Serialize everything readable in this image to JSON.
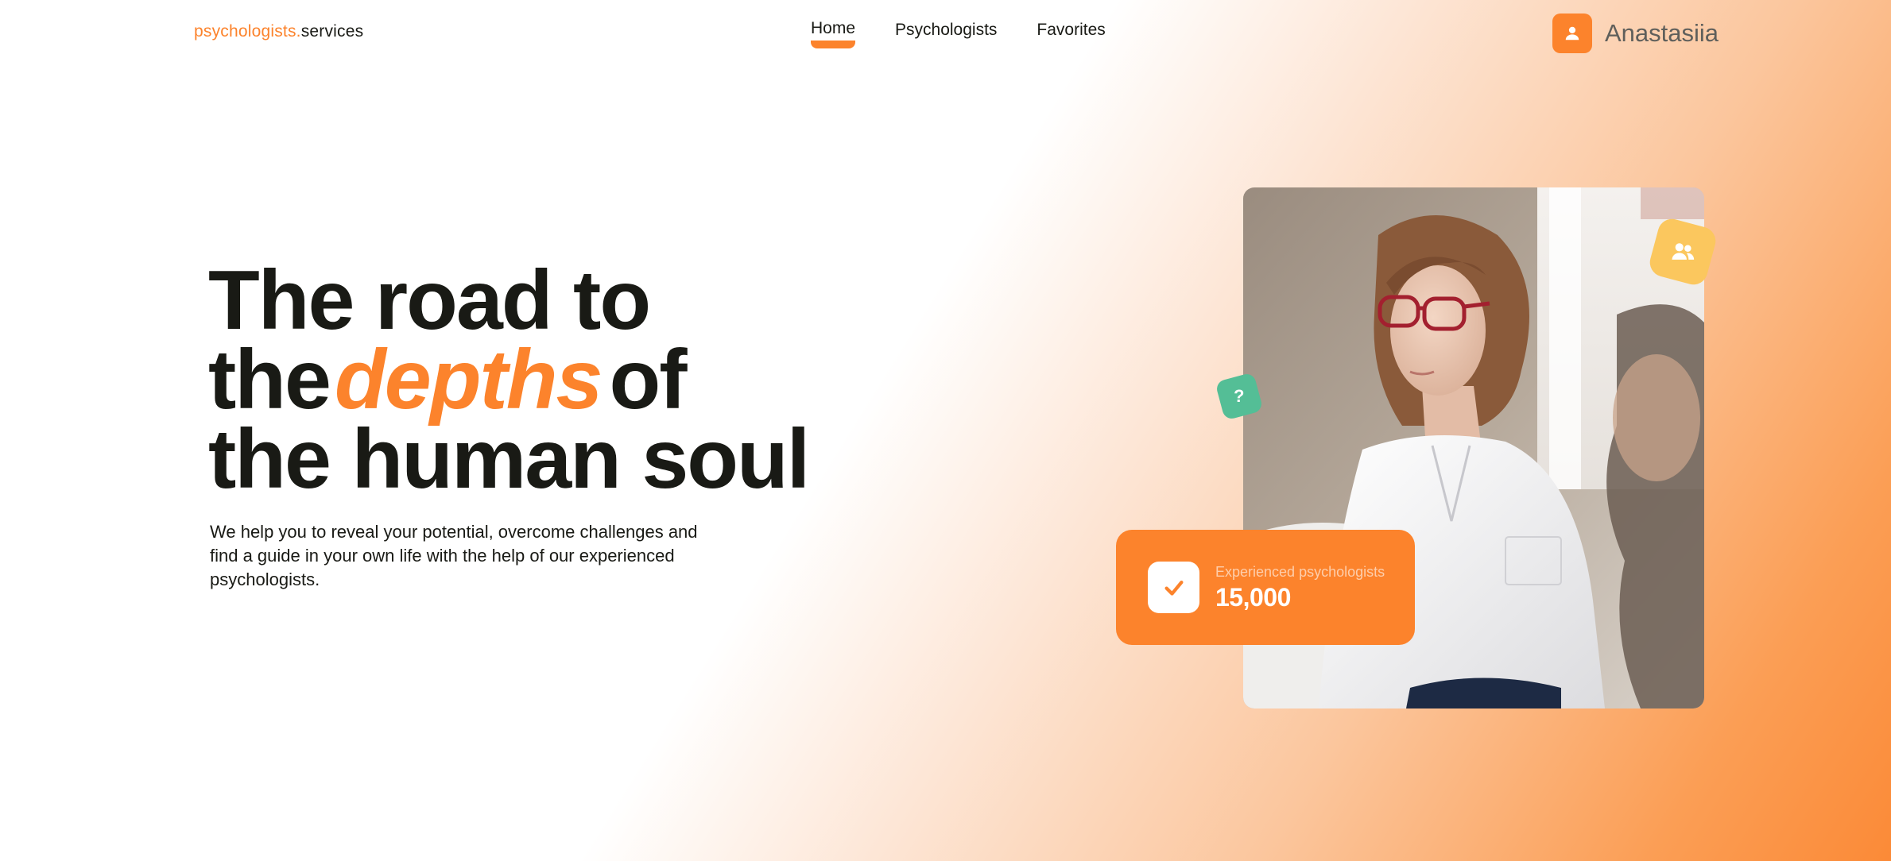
{
  "header": {
    "logo_accent": "psychologists.",
    "logo_rest": "services",
    "nav": [
      {
        "label": "Home",
        "active": true
      },
      {
        "label": "Psychologists",
        "active": false
      },
      {
        "label": "Favorites",
        "active": false
      }
    ],
    "user_name": "Anastasiia",
    "user_icon": "user-icon"
  },
  "hero": {
    "title_line1": "The road to",
    "title_line2_start": "the",
    "title_line2_emphasis": "depths",
    "title_line2_end": "of",
    "title_line3": "the human soul",
    "description": "We help you to reveal your potential, overcome challenges and find a guide in your own life with the help of our experienced psychologists."
  },
  "stats": {
    "label": "Experienced psychologists",
    "value": "15,000",
    "icon": "check-icon"
  },
  "badges": {
    "question_mark": "?",
    "people_icon": "users-icon"
  },
  "colors": {
    "accent": "#fc832c",
    "text": "#191a15",
    "yellow_badge": "#fbc75e",
    "green_badge": "#54be96"
  }
}
